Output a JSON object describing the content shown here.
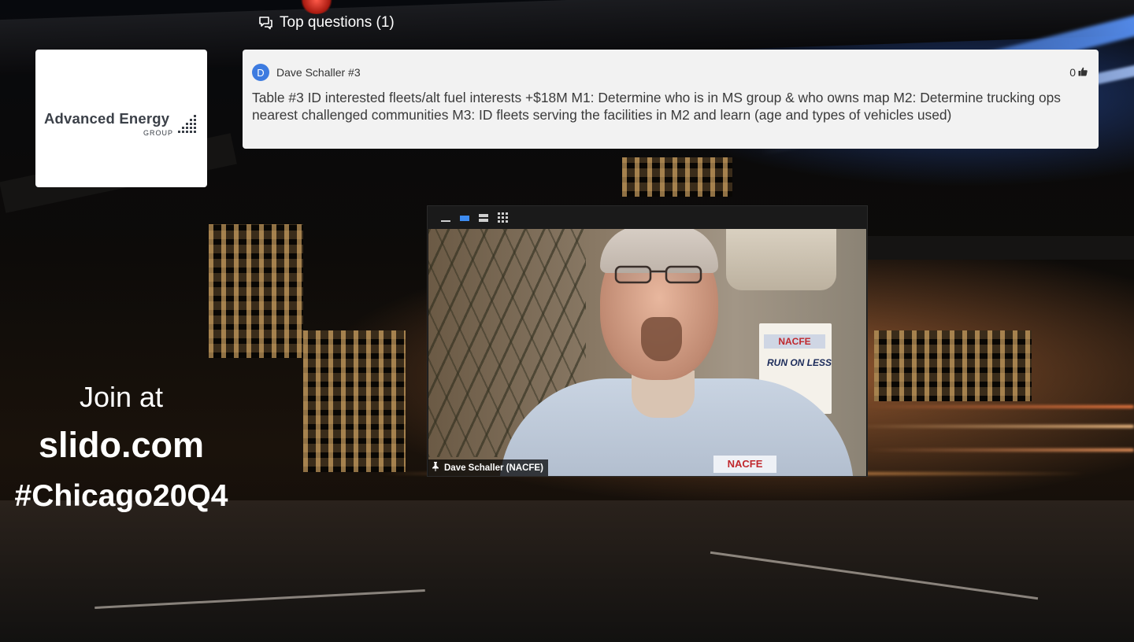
{
  "top_questions": {
    "label": "Top questions (1)"
  },
  "logo": {
    "main": "Advanced Energy",
    "sub": "GROUP"
  },
  "question": {
    "avatar_letter": "D",
    "author": "Dave Schaller #3",
    "votes": "0",
    "text": "Table #3 ID interested fleets/alt fuel interests +$18M M1: Determine who is in MS group & who owns map M2: Determine trucking ops nearest challenged communities M3: ID fleets serving the facilities in M2 and learn (age and types of vehicles used)"
  },
  "join": {
    "line1": "Join at",
    "site": "slido.com",
    "hashtag": "#Chicago20Q4"
  },
  "video": {
    "participant_name": "Dave Schaller (NACFE)",
    "sign_top": "NACFE",
    "sign_body": "RUN ON LESS",
    "shirt_logo": "NACFE",
    "active_layout": "speaker"
  },
  "colors": {
    "avatar": "#3d7be0",
    "active_layout_button": "#3d8bf0"
  }
}
